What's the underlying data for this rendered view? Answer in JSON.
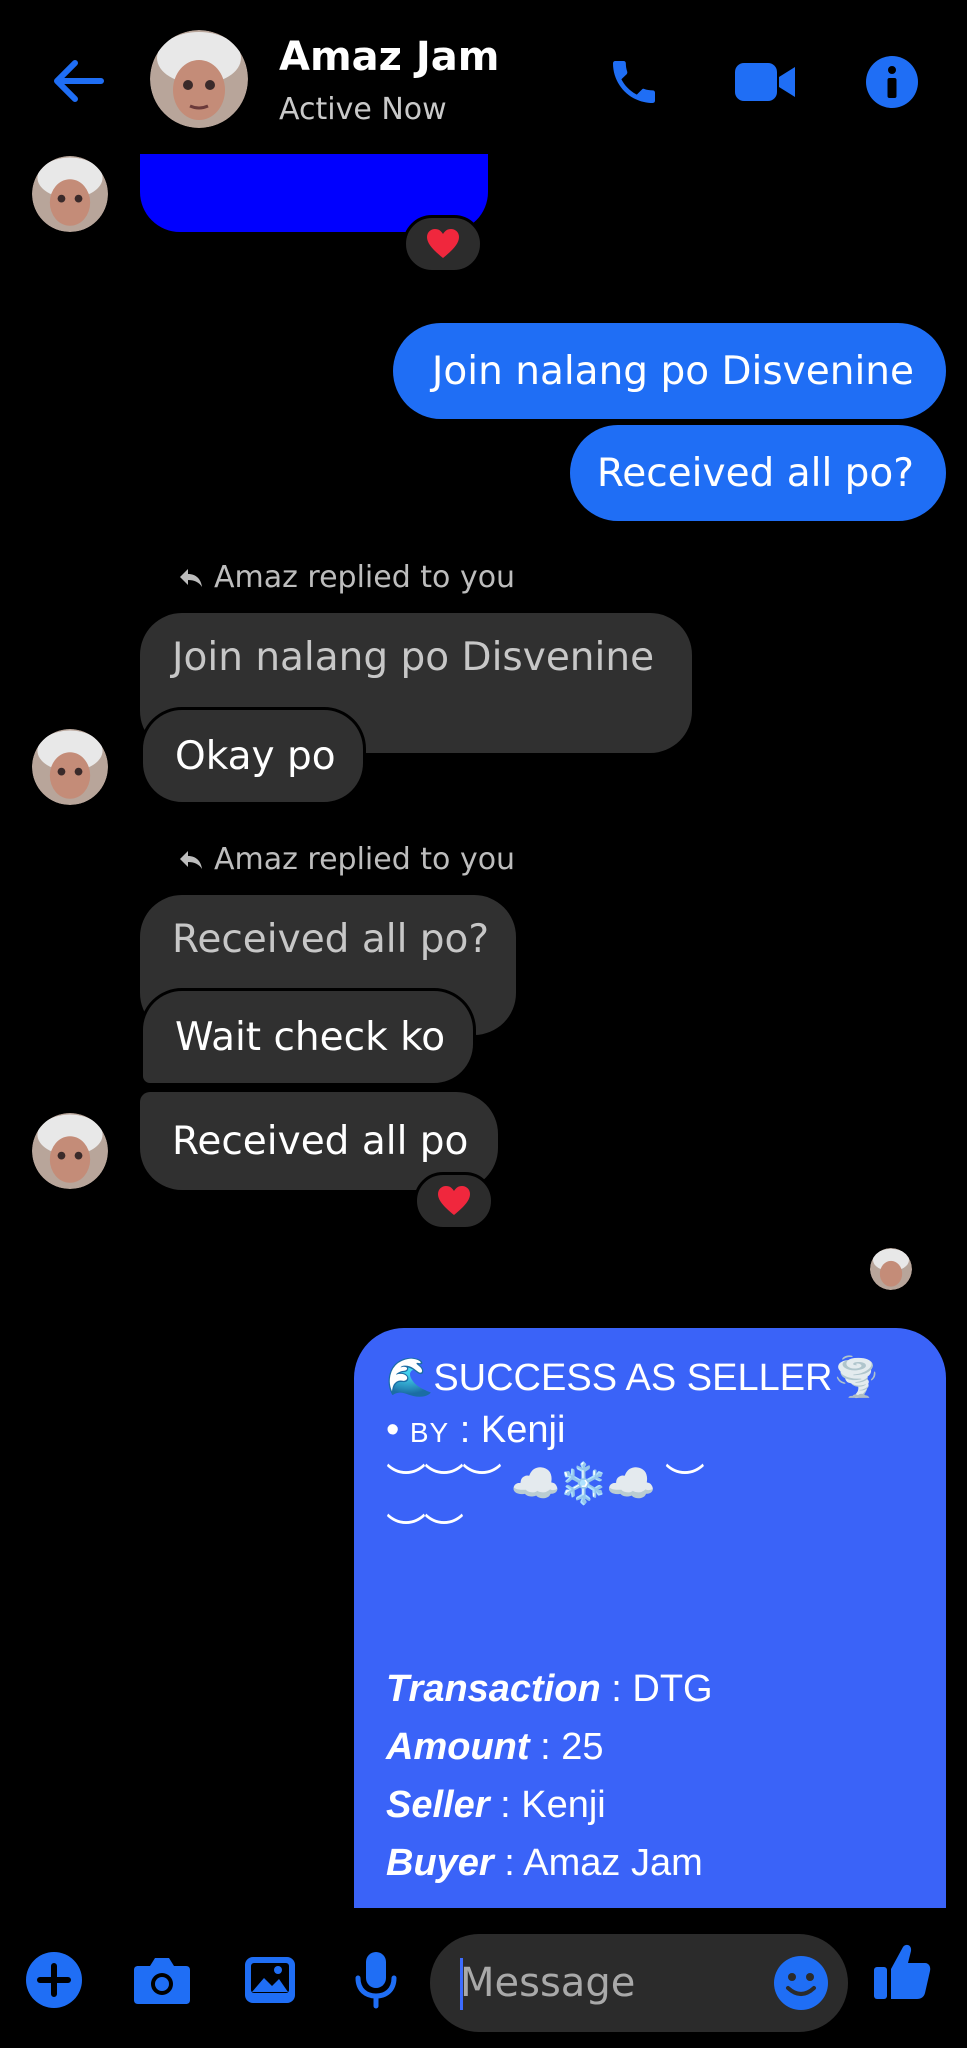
{
  "header": {
    "name": "Amaz Jam",
    "status": "Active Now",
    "icons": [
      "back-arrow-icon",
      "phone-icon",
      "video-icon",
      "info-icon"
    ]
  },
  "messages": {
    "out1": "Join nalang po Disvenine",
    "out2": "Received all po?",
    "reply1_label": "Amaz replied to you",
    "reply1_quoted": "Join nalang po Disvenine",
    "reply1_text": "Okay po",
    "reply2_label": "Amaz replied to you",
    "reply2_quoted": "Received all po?",
    "reply2_text": "Wait check ko",
    "in3": "Received all po"
  },
  "card": {
    "line1": "SUCCESS AS SELLER",
    "by_label": "BY",
    "by_value": "Kenji",
    "squiggle1": "︶︶︶",
    "squiggle2": "︶︶",
    "transaction_label": "Transaction",
    "transaction_value": "DTG",
    "amount_label": "Amount",
    "amount_value": "25",
    "seller_label": "Seller",
    "seller_value": "Kenji",
    "buyer_label": "Buyer",
    "buyer_value": "Amaz Jam"
  },
  "composer": {
    "placeholder": "Message"
  },
  "colors": {
    "accent": "#1f6ef5",
    "card": "#3a63f8",
    "incoming": "#303030",
    "background": "#000000"
  }
}
